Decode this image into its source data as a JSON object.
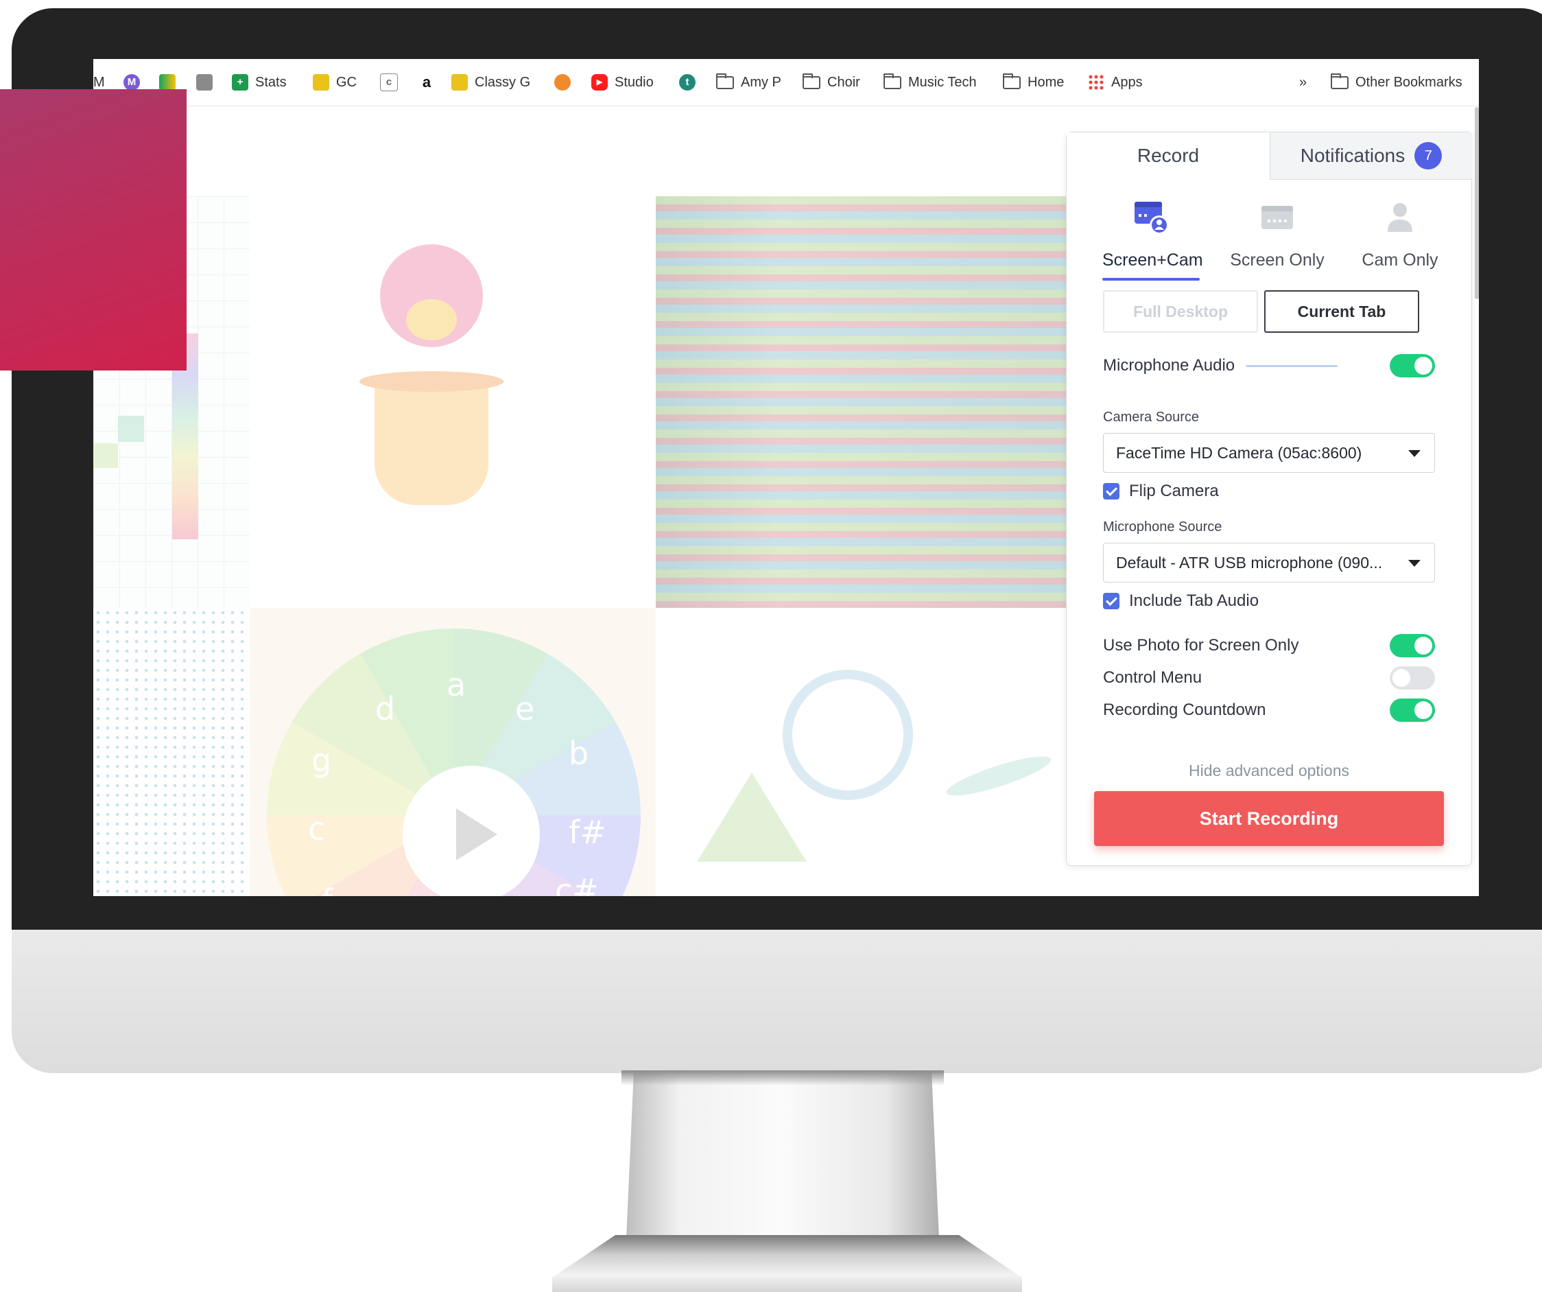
{
  "bookmarks": {
    "items": [
      {
        "label": "Stats",
        "icon": "green-plus-icon"
      },
      {
        "label": "GC",
        "icon": "classroom-icon"
      },
      {
        "label": "Classy G",
        "icon": "classroom-icon"
      },
      {
        "label": "Studio",
        "icon": "youtube-icon"
      },
      {
        "label": "Amy P",
        "icon": "folder-icon"
      },
      {
        "label": "Choir",
        "icon": "folder-icon"
      },
      {
        "label": "Music Tech",
        "icon": "folder-icon"
      },
      {
        "label": "Home",
        "icon": "folder-icon"
      },
      {
        "label": "Apps",
        "icon": "apps-grid-icon"
      }
    ],
    "lead_char": "M",
    "amazon_char": "a",
    "t_char": "t",
    "overflow": "»",
    "other": "Other Bookmarks"
  },
  "wheel": {
    "notes": [
      "a",
      "d",
      "e",
      "g",
      "b",
      "c",
      "f#",
      "f",
      "c#"
    ]
  },
  "panel": {
    "tabs": {
      "record": "Record",
      "notifications": "Notifications",
      "notifications_count": "7"
    },
    "modes": [
      {
        "label": "Screen+Cam",
        "icon": "screen-cam-icon",
        "active": true
      },
      {
        "label": "Screen Only",
        "icon": "screen-icon",
        "active": false
      },
      {
        "label": "Cam Only",
        "icon": "person-icon",
        "active": false
      }
    ],
    "capture": {
      "full_desktop": "Full Desktop",
      "current_tab": "Current Tab",
      "selected": "Current Tab"
    },
    "microphone_audio": {
      "label": "Microphone Audio",
      "enabled": true
    },
    "camera_source": {
      "label": "Camera Source",
      "value": "FaceTime HD Camera (05ac:8600)"
    },
    "flip_camera": {
      "label": "Flip Camera",
      "checked": true
    },
    "microphone_source": {
      "label": "Microphone Source",
      "value": "Default - ATR USB microphone (090..."
    },
    "include_tab_audio": {
      "label": "Include Tab Audio",
      "checked": true
    },
    "use_photo": {
      "label": "Use Photo for Screen Only",
      "enabled": true
    },
    "control_menu": {
      "label": "Control Menu",
      "enabled": false
    },
    "recording_countdown": {
      "label": "Recording Countdown",
      "enabled": true
    },
    "hide_advanced": "Hide advanced options",
    "start_recording": "Start Recording"
  },
  "colors": {
    "accent": "#5260e6",
    "toggle_on": "#1dcf7d",
    "start_button": "#f05a5a",
    "pink_block": "#d0224d"
  }
}
